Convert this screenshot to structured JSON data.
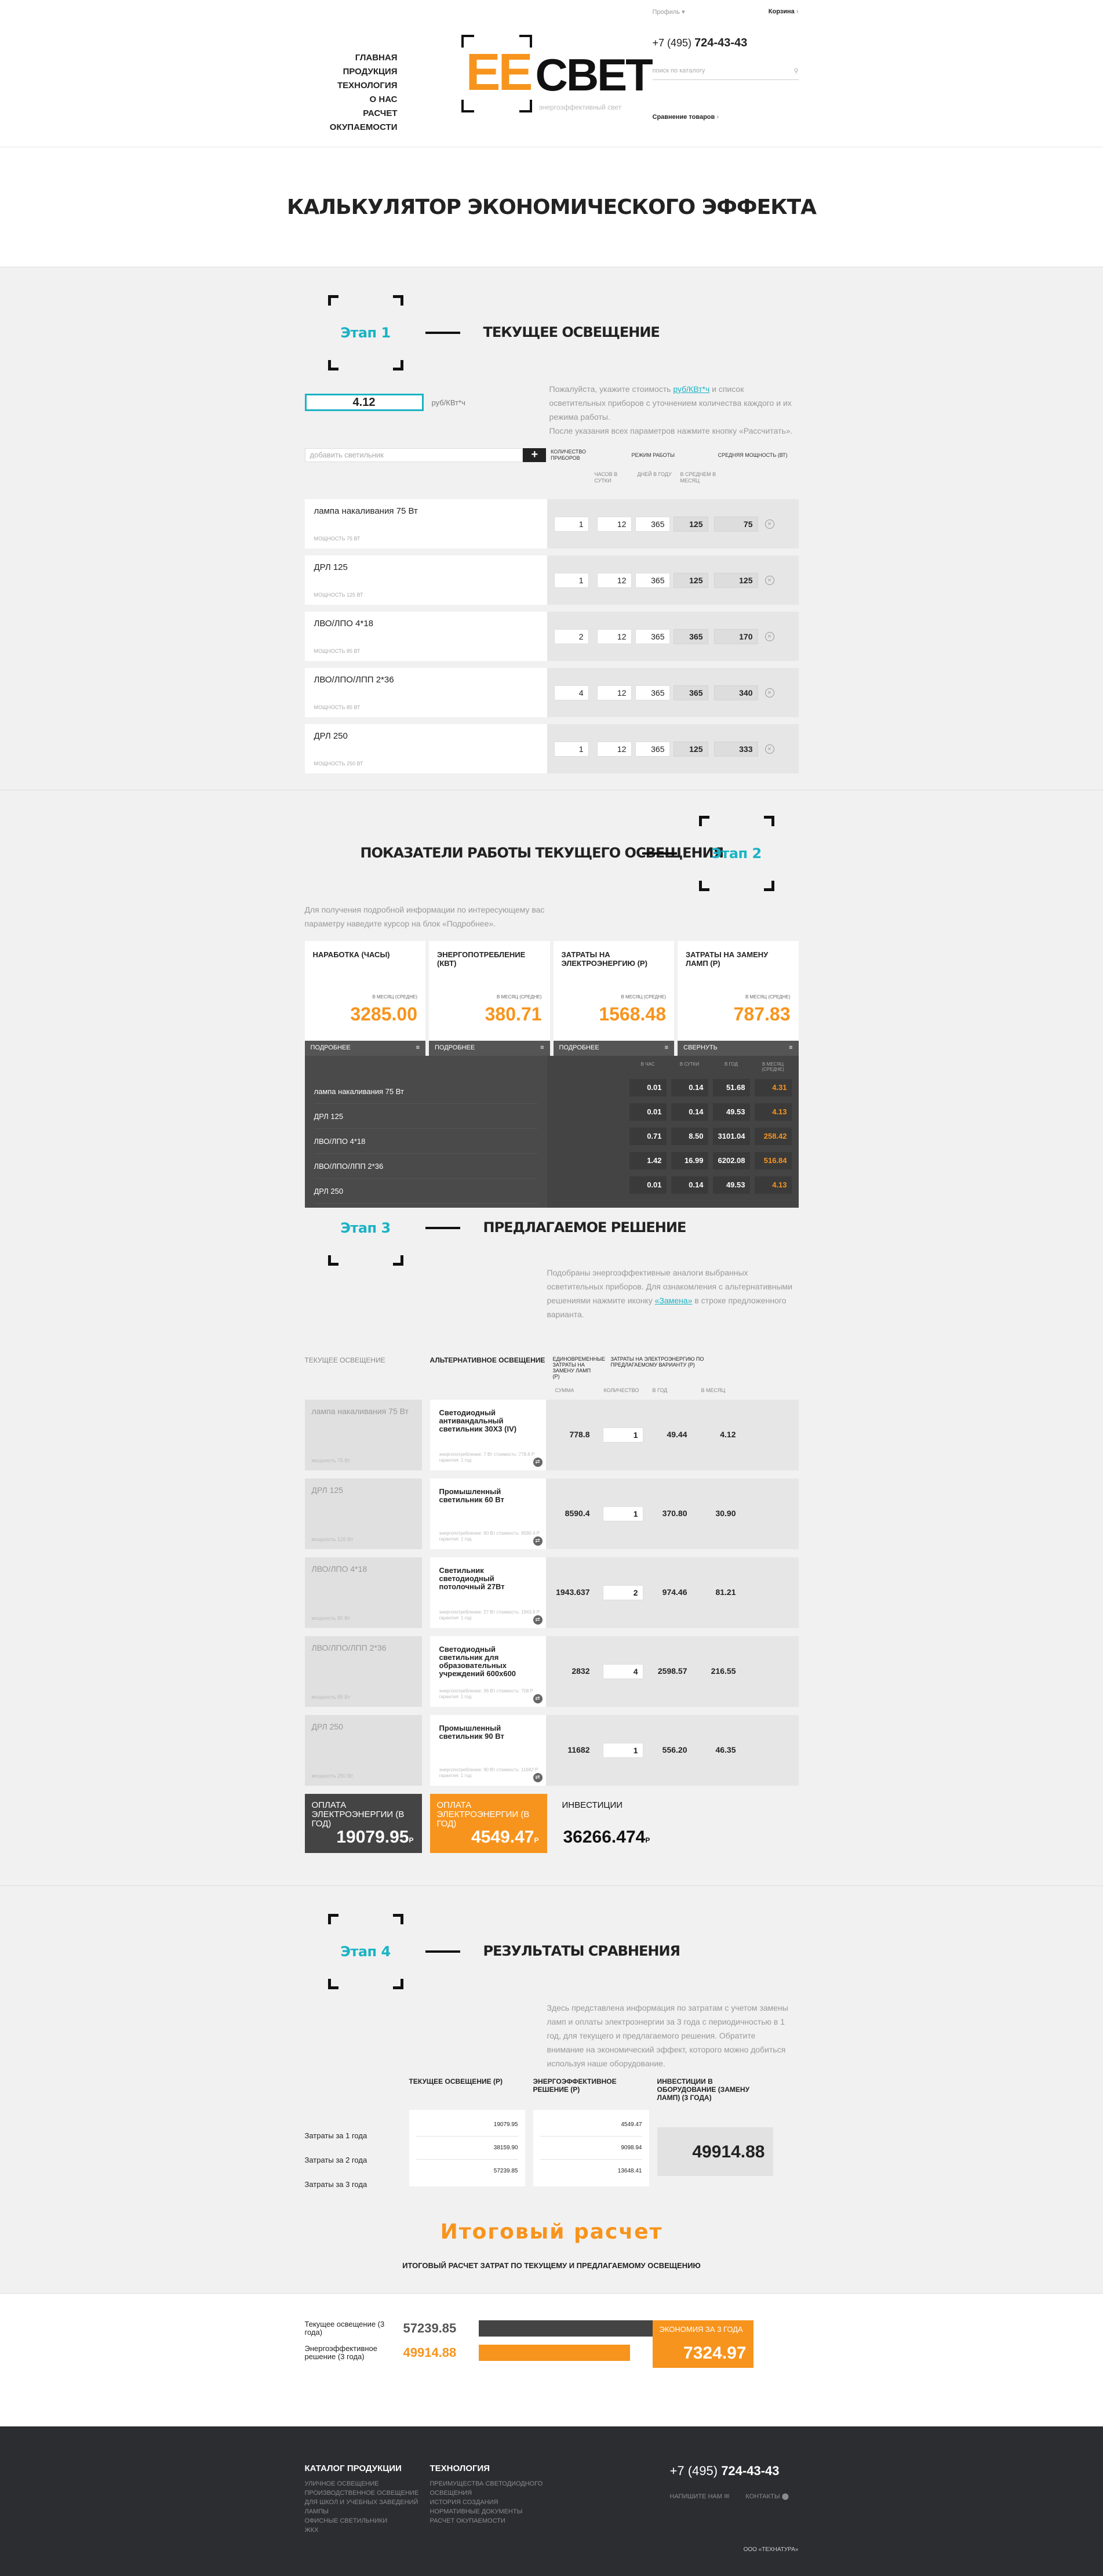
{
  "header": {
    "nav": [
      "Главная",
      "Продукция",
      "Технология",
      "О нас",
      "Расчет окупаемости"
    ],
    "logo_ee": "ЕЕ",
    "logo_svet": "СВЕТ",
    "logo_tagline": "энергоэффективный свет",
    "profile": "Профиль",
    "cart": "Корзина",
    "phone_prefix": "+7 (495)",
    "phone_number": "724-43-43",
    "search_placeholder": "поиск по каталогу",
    "compare": "Сравнение товаров"
  },
  "page_title": "Калькулятор экономического эффекта",
  "stage1": {
    "badge": "Этап 1",
    "title": "Текущее освещение",
    "desc_1": "Пожалуйста, укажите стоимость",
    "desc_link": "руб/КВт*ч",
    "desc_2": "и список осветительных приборов с уточнением количества каждого и их режима работы.",
    "desc_3": "После указания всех параметров нажмите кнопку «Рассчитать».",
    "tariff_value": "4.12",
    "tariff_unit": "руб/КВт*ч",
    "add_placeholder": "добавить светильник",
    "add_button": "+",
    "col_qty": "Количество приборов",
    "col_mode": "Режим работы",
    "col_power": "Средняя мощность (Вт)",
    "sub_hours": "часов в сутки",
    "sub_days": "дней в году",
    "sub_avg": "в среднем в месяц",
    "rows": [
      {
        "name": "лампа накаливания 75 Вт",
        "power": "мощность 75 Вт",
        "qty": "1",
        "hours": "12",
        "days": "365",
        "month": "125",
        "avg": "75"
      },
      {
        "name": "ДРЛ 125",
        "power": "мощность 125 Вт",
        "qty": "1",
        "hours": "12",
        "days": "365",
        "month": "125",
        "avg": "125"
      },
      {
        "name": "ЛВО/ЛПО 4*18",
        "power": "мощность 85 Вт",
        "qty": "2",
        "hours": "12",
        "days": "365",
        "month": "365",
        "avg": "170"
      },
      {
        "name": "ЛВО/ЛПО/ЛПП 2*36",
        "power": "мощность 85 Вт",
        "qty": "4",
        "hours": "12",
        "days": "365",
        "month": "365",
        "avg": "340"
      },
      {
        "name": "ДРЛ 250",
        "power": "мощность 250 Вт",
        "qty": "1",
        "hours": "12",
        "days": "365",
        "month": "125",
        "avg": "333"
      }
    ]
  },
  "stage2": {
    "badge": "Этап 2",
    "title": "Показатели работы текущего освещения",
    "desc": "Для получения подробной информации по интересующему вас параметру наведите курсор на блок «Подробнее».",
    "cards": [
      {
        "title": "Наработка (часы)",
        "sub": "в месяц (средне)",
        "value": "3285.00",
        "btn": "Подробнее"
      },
      {
        "title": "Энергопотребление (КВт)",
        "sub": "в месяц (средне)",
        "value": "380.71",
        "btn": "Подробнее"
      },
      {
        "title": "Затраты на электроэнергию (Р)",
        "sub": "в месяц (средне)",
        "value": "1568.48",
        "btn": "Подробнее"
      },
      {
        "title": "Затраты на замену ламп (Р)",
        "sub": "в месяц (средне)",
        "value": "787.83",
        "btn": "Свернуть"
      }
    ],
    "detail_head": [
      "в час",
      "в сутки",
      "в год",
      "в месяц (средне)"
    ],
    "detail_names": [
      "лампа накаливания 75 Вт",
      "ДРЛ 125",
      "ЛВО/ЛПО 4*18",
      "ЛВО/ЛПО/ЛПП 2*36",
      "ДРЛ 250"
    ],
    "detail_rows": [
      [
        "0.01",
        "0.14",
        "51.68",
        "4.31"
      ],
      [
        "0.01",
        "0.14",
        "49.53",
        "4.13"
      ],
      [
        "0.71",
        "8.50",
        "3101.04",
        "258.42"
      ],
      [
        "1.42",
        "16.99",
        "6202.08",
        "516.84"
      ],
      [
        "0.01",
        "0.14",
        "49.53",
        "4.13"
      ]
    ]
  },
  "stage3": {
    "badge": "Этап 3",
    "title": "Предлагаемое решение",
    "desc_1": "Подобраны энергоэффективные аналоги выбранных осветительных приборов. Для ознакомления с альтернативными решениями нажмите иконку",
    "desc_link": "«Замена»",
    "desc_2": "в строке предложенного варианта.",
    "head_cur": "Текущее освещение",
    "head_alt": "Альтернативное освещение",
    "head_once": "Единовременные затраты на замену ламп (Р)",
    "head_energy": "Затраты на электроэнергию по предлагаемому варианту (Р)",
    "sub": [
      "сумма",
      "количество",
      "в год",
      "в месяц"
    ],
    "rows": [
      {
        "cur": "лампа накаливания 75 Вт",
        "cur_p": "мощность 75 Вт",
        "alt": "Светодиодный антивандальный светильник 30Х3 (IV)",
        "alt_p": "энергопотребление: 7 Вт стоимость: 778.8 Р гарантия: 1 год",
        "sum": "778.8",
        "qty": "1",
        "year": "49.44",
        "month": "4.12"
      },
      {
        "cur": "ДРЛ 125",
        "cur_p": "мощность 125 Вт",
        "alt": "Промышленный светильник 60 Вт",
        "alt_p": "энергопотребление: 60 Вт стоимость: 8590.4 Р гарантия: 1 год",
        "sum": "8590.4",
        "qty": "1",
        "year": "370.80",
        "month": "30.90"
      },
      {
        "cur": "ЛВО/ЛПО 4*18",
        "cur_p": "мощность 85 Вт",
        "alt": "Светильник светодиодный потолочный 27Вт",
        "alt_p": "энергопотребление: 27 Вт стоимость: 1943.6 Р гарантия: 1 год",
        "sum": "1943.637",
        "qty": "2",
        "year": "974.46",
        "month": "81.21"
      },
      {
        "cur": "ЛВО/ЛПО/ЛПП 2*36",
        "cur_p": "мощность 85 Вт",
        "alt": "Светодиодный светильник для образовательных учреждений 600х600",
        "alt_p": "энергопотребление: 36 Вт стоимость: 708 Р гарантия: 1 год",
        "sum": "2832",
        "qty": "4",
        "year": "2598.57",
        "month": "216.55"
      },
      {
        "cur": "ДРЛ 250",
        "cur_p": "мощность 250 Вт",
        "alt": "Промышленный светильник 90 Вт",
        "alt_p": "энергопотребление: 90 Вт стоимость: 11682 Р гарантия: 1 год",
        "sum": "11682",
        "qty": "1",
        "year": "556.20",
        "month": "46.35"
      }
    ],
    "tot1_label": "Оплата электроэнергии (в год)",
    "tot1_value": "19079.95",
    "tot2_label": "Оплата электроэнергии (в год)",
    "tot2_value": "4549.47",
    "tot3_label": "Инвестиции",
    "tot3_value": "36266.474",
    "rub": "Р"
  },
  "stage4": {
    "badge": "Этап 4",
    "title": "Результаты сравнения",
    "desc": "Здесь представлена информация по затратам с учетом замены ламп и оплаты электроэнергии за 3 года с периодичностью в 1 год, для текущего и предлагаемого решения. Обратите внимание на экономический эффект, которого можно добиться используя наше оборудование.",
    "labels": [
      "Затраты за 1 года",
      "Затраты за 2 года",
      "Затраты за 3 года"
    ],
    "col1": "Текущее освещение (Р)",
    "col2": "Энергоэффективное решение (Р)",
    "col3": "Инвестиции в оборудование (замену ламп) (3 года)",
    "col1_vals": [
      "19079.95",
      "38159.90",
      "57239.85"
    ],
    "col2_vals": [
      "4549.47",
      "9098.94",
      "13648.41"
    ],
    "col3_val": "49914.88"
  },
  "itog": {
    "title": "Итоговый расчет",
    "subtitle": "Итоговый расчет затрат по текущему и предлагаемому освещению",
    "cur_label": "Текущее освещение (3 года)",
    "cur_value": "57239.85",
    "new_label": "Энергоэффективное решение (3 года)",
    "new_value": "49914.88",
    "economy_label": "Экономия за 3 года",
    "economy_value": "7324.97",
    "cur_ratio": 1.0,
    "new_ratio": 0.87
  },
  "footer": {
    "cat_title": "Каталог продукции",
    "cat_items": [
      "Уличное освещение",
      "Производственное освещение",
      "Для школ и учебных заведений",
      "Лампы",
      "Офисные светильники",
      "ЖКХ"
    ],
    "tech_title": "Технология",
    "tech_items": [
      "Преимущества светодиодного освещения",
      "История создания",
      "Нормативные документы",
      "Расчет окупаемости"
    ],
    "phone_prefix": "+7 (495)",
    "phone_number": "724-43-43",
    "write": "Напишите нам",
    "contacts": "Контакты",
    "copyright": "ООО «ТЕХНАТУРА»"
  },
  "colors": {
    "accent": "#f7941d",
    "teal": "#1ab3c4",
    "dark": "#2c2d30"
  }
}
